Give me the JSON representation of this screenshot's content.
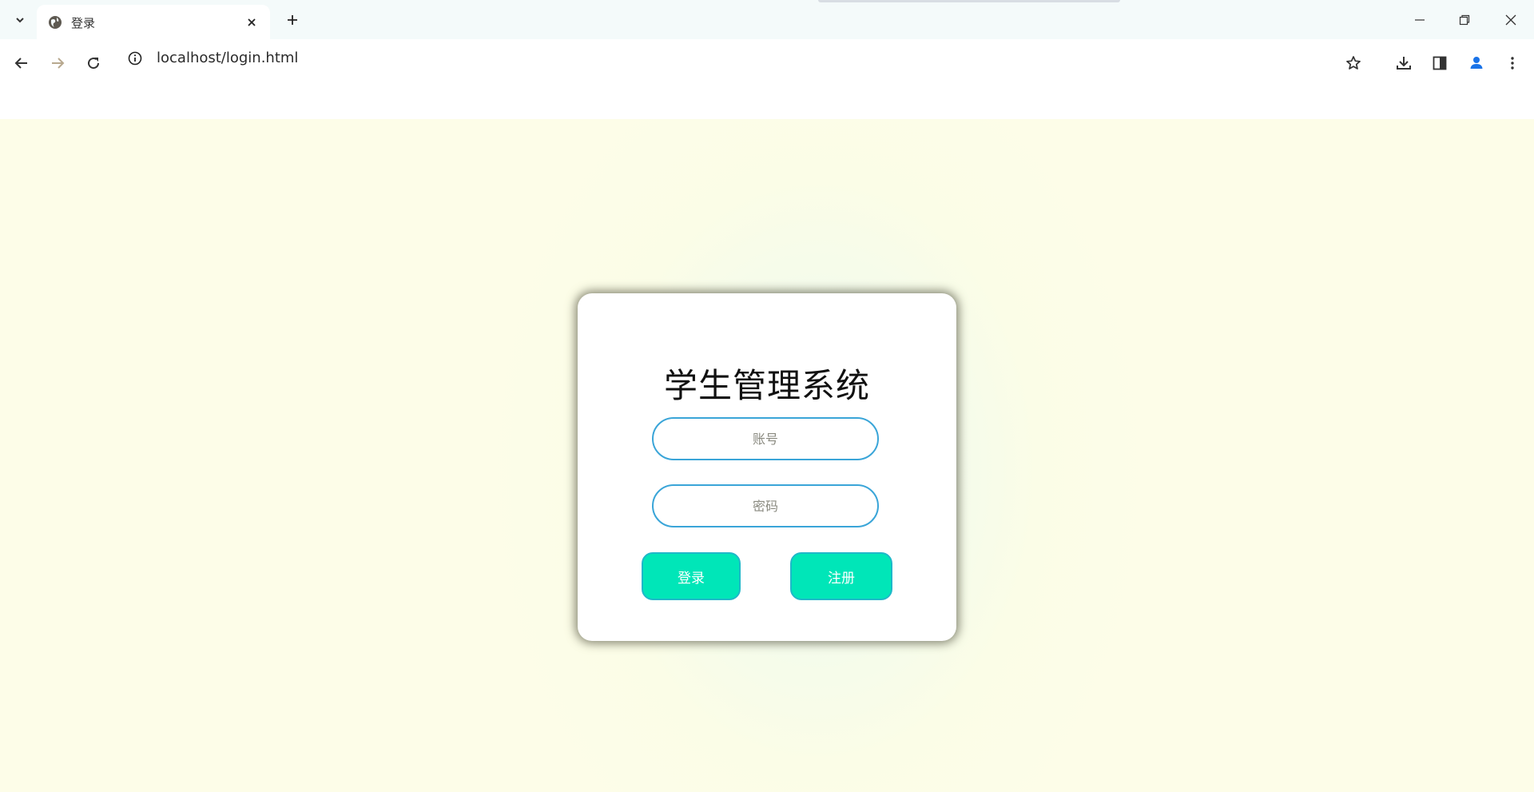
{
  "browser": {
    "tab": {
      "title": "登录"
    },
    "address_bar": {
      "url": "localhost/login.html"
    }
  },
  "login": {
    "title": "学生管理系统",
    "account_placeholder": "账号",
    "password_placeholder": "密码",
    "login_label": "登录",
    "register_label": "注册"
  },
  "colors": {
    "accent_button": "#00e6b8",
    "input_border": "#3aa5d8",
    "profile_icon": "#1a73e8"
  },
  "icons": {
    "tab_list": "chevron-down-icon",
    "favicon": "globe-icon",
    "close": "close-icon",
    "new_tab": "plus-icon",
    "back": "back-arrow-icon",
    "forward": "forward-arrow-icon",
    "reload": "reload-icon",
    "site_info": "info-icon",
    "bookmark": "star-icon",
    "downloads": "download-icon",
    "side_panel": "side-panel-icon",
    "profile": "profile-icon",
    "menu": "kebab-menu-icon"
  }
}
